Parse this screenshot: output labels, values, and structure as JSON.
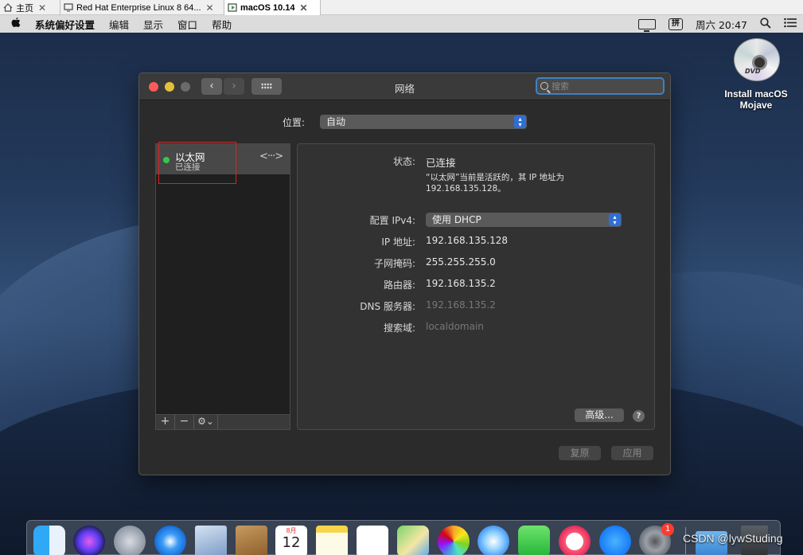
{
  "vm_tabs": [
    {
      "label": "主页"
    },
    {
      "label": "Red Hat Enterprise Linux 8 64..."
    },
    {
      "label": "macOS 10.14"
    }
  ],
  "menubar": {
    "app_name": "系统偏好设置",
    "items": [
      "编辑",
      "显示",
      "窗口",
      "帮助"
    ],
    "ime": "拼",
    "clock": "周六 20:47"
  },
  "desktop": {
    "dvd_label_line1": "Install macOS",
    "dvd_label_line2": "Mojave",
    "dvd_text": "DVD"
  },
  "window": {
    "title": "网络",
    "search_placeholder": "搜索",
    "location_label": "位置:",
    "location_value": "自动",
    "service": {
      "name": "以太网",
      "status": "已连接",
      "status_color": "#34c84a"
    },
    "toolbar": {
      "add": "+",
      "remove": "−",
      "gear": "⚙⌄"
    },
    "detail": {
      "status_label": "状态:",
      "status_value": "已连接",
      "status_desc_line1": "“以太网”当前是活跃的，其 IP 地址为",
      "status_desc_line2": "192.168.135.128。",
      "ipv4_label": "配置 IPv4:",
      "ipv4_value": "使用 DHCP",
      "ip_label": "IP 地址:",
      "ip_value": "192.168.135.128",
      "mask_label": "子网掩码:",
      "mask_value": "255.255.255.0",
      "router_label": "路由器:",
      "router_value": "192.168.135.2",
      "dns_label": "DNS 服务器:",
      "dns_value": "192.168.135.2",
      "search_domain_label": "搜索域:",
      "search_domain_value": "localdomain",
      "advanced_button": "高级...",
      "help_button": "?"
    },
    "revert_button": "复原",
    "apply_button": "应用"
  },
  "dock": {
    "calendar_month": "8月",
    "calendar_day": "12",
    "prefs_badge": "1"
  },
  "watermark": "CSDN @lywStuding"
}
